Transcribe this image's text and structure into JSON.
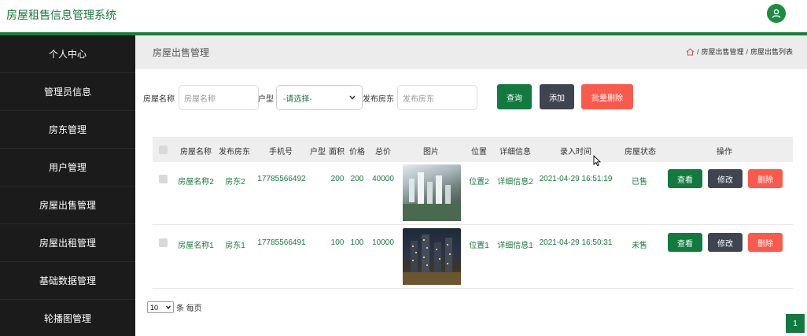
{
  "app": {
    "title": "房屋租售信息管理系统"
  },
  "sidebar": {
    "items": [
      {
        "label": "个人中心"
      },
      {
        "label": "管理员信息"
      },
      {
        "label": "房东管理"
      },
      {
        "label": "用户管理"
      },
      {
        "label": "房屋出售管理"
      },
      {
        "label": "房屋出租管理"
      },
      {
        "label": "基础数据管理"
      },
      {
        "label": "轮播图管理"
      }
    ]
  },
  "page": {
    "title": "房屋出售管理",
    "breadcrumb": [
      "房屋出售管理",
      "房屋出售列表"
    ],
    "breadcrumb_sep": "/"
  },
  "filter": {
    "name_label": "房屋名称",
    "name_placeholder": "房屋名称",
    "type_label": "户型",
    "type_selected": "-请选择-",
    "landlord_label": "发布房东",
    "landlord_placeholder": "发布房东",
    "query_button": "查询",
    "add_button": "添加",
    "batch_delete_button": "批量删除"
  },
  "table": {
    "headers": [
      "房屋名称",
      "发布房东",
      "手机号",
      "户型",
      "面积",
      "价格",
      "总价",
      "图片",
      "位置",
      "详细信息",
      "录入时间",
      "房屋状态",
      "操作"
    ],
    "rows": [
      {
        "name": "房屋名称2",
        "landlord": "房东2",
        "phone": "17785566492",
        "type": "",
        "area": "200",
        "price": "200",
        "total": "40000",
        "location": "位置2",
        "detail": "详细信息2",
        "time": "2021-04-29 16:51:19",
        "status": "已售"
      },
      {
        "name": "房屋名称1",
        "landlord": "房东1",
        "phone": "17785566491",
        "type": "",
        "area": "100",
        "price": "100",
        "total": "10000",
        "location": "位置1",
        "detail": "详细信息1",
        "time": "2021-04-29 16:50:31",
        "status": "未售"
      }
    ],
    "actions": {
      "view": "查看",
      "edit": "修改",
      "delete": "删除"
    }
  },
  "pagination": {
    "page_size": "10",
    "page_size_suffix": "条 每页",
    "current_page": "1"
  },
  "colors": {
    "brand_green": "#127a3e",
    "sidebar_bg": "#1b1b1b",
    "danger": "#fa5a4b",
    "dark_button": "#3f4451"
  }
}
